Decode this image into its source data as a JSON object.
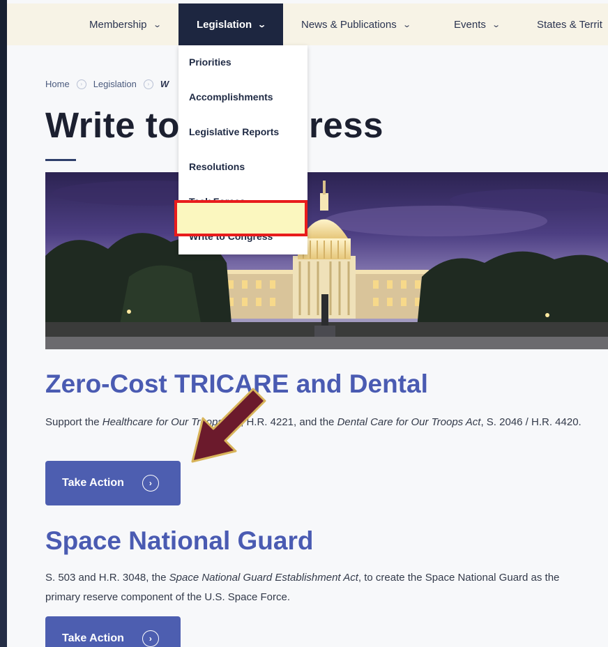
{
  "nav": {
    "items": [
      {
        "label": "Membership"
      },
      {
        "label": "Legislation"
      },
      {
        "label": "News & Publications"
      },
      {
        "label": "Events"
      },
      {
        "label": "States & Territ"
      }
    ],
    "chevron": "⌄"
  },
  "dropdown": {
    "items": [
      "Priorities",
      "Accomplishments",
      "Legislative Reports",
      "Resolutions",
      "Task Forces",
      "Write to Congress"
    ]
  },
  "breadcrumb": {
    "home": "Home",
    "legislation": "Legislation",
    "current": "W"
  },
  "page_title": {
    "part1": "Write to",
    "part2": "ress"
  },
  "sections": [
    {
      "title": "Zero-Cost TRICARE and Dental",
      "body": {
        "t1": "Support the ",
        "i1": "Healthcare for Our Troops Act",
        "t2": ", H.R. 4221, and the ",
        "i2": "Dental Care for Our Troops Act",
        "t3": ", S. 2046 / H.R. 4420."
      },
      "button": "Take Action"
    },
    {
      "title": "Space National Guard",
      "body": {
        "t1": "S. 503 and H.R. 3048, the ",
        "i1": "Space National Guard Establishment Act",
        "t2": ", to create the Space National Guard as the primary reserve component of the U.S. Space Force."
      },
      "button": "Take Action"
    }
  ],
  "colors": {
    "nav_bg": "#f7f3e6",
    "nav_active": "#1d2640",
    "accent": "#4a5bb2",
    "button": "#4d5eb0",
    "highlight_border": "#e81c1c",
    "arrow": "#6b1a2c"
  }
}
